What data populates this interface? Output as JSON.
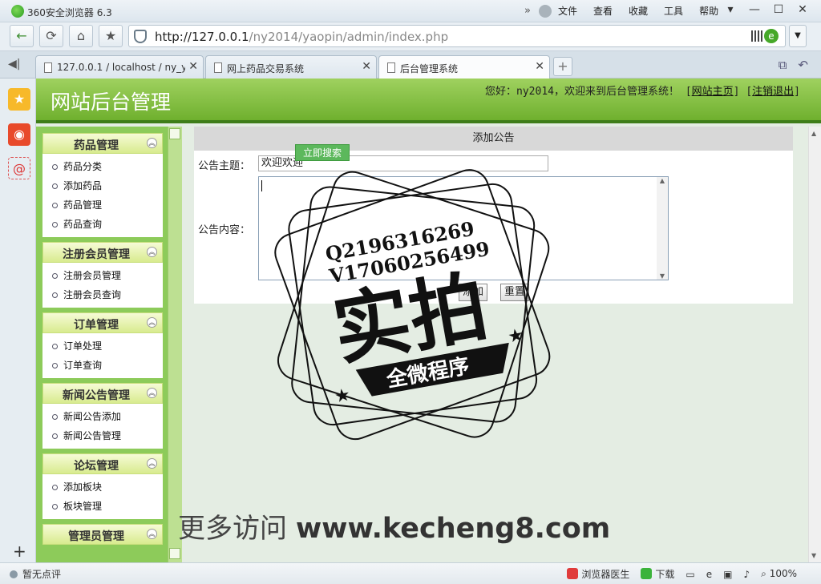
{
  "browser": {
    "title": "360安全浏览器 6.3",
    "menus": [
      "文件",
      "查看",
      "收藏",
      "工具",
      "帮助"
    ],
    "url_host": "http://127.0.0.1",
    "url_path": "/ny2014/yaopin/admin/index.php",
    "tabs": [
      {
        "label": "127.0.0.1 / localhost / ny_ya"
      },
      {
        "label": "网上药品交易系统"
      },
      {
        "label": "后台管理系统"
      }
    ],
    "new_tab": "+",
    "status_left": "暂无点评",
    "status_right": {
      "doctor": "浏览器医生",
      "download": "下载",
      "zoom": "100%"
    }
  },
  "header": {
    "title": "网站后台管理",
    "welcome": "您好：ny2014，欢迎来到后台管理系统！",
    "home_link": "网站主页",
    "logout_link": "注销退出"
  },
  "nav": {
    "groups": [
      {
        "title": "药品管理",
        "items": [
          "药品分类",
          "添加药品",
          "药品管理",
          "药品查询"
        ]
      },
      {
        "title": "注册会员管理",
        "items": [
          "注册会员管理",
          "注册会员查询"
        ]
      },
      {
        "title": "订单管理",
        "items": [
          "订单处理",
          "订单查询"
        ]
      },
      {
        "title": "新闻公告管理",
        "items": [
          "新闻公告添加",
          "新闻公告管理"
        ]
      },
      {
        "title": "论坛管理",
        "items": [
          "添加板块",
          "板块管理"
        ]
      },
      {
        "title": "管理员管理",
        "items": []
      }
    ]
  },
  "form": {
    "heading": "添加公告",
    "subject_label": "公告主题：",
    "subject_value": "欢迎欢迎",
    "content_label": "公告内容：",
    "submit_label": "添加",
    "reset_label": "重置",
    "tooltip": "立即搜索"
  },
  "stamp": {
    "qq": "Q2196316269",
    "wechat": "V17060256499",
    "big": "实拍",
    "band": "全微程序"
  },
  "watermark": {
    "prefix": "更多访问",
    "site": "www.kecheng8.com"
  }
}
